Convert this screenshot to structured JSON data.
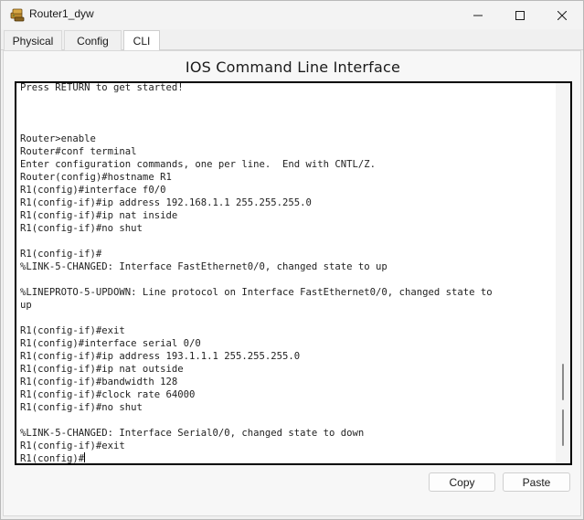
{
  "window": {
    "title": "Router1_dyw",
    "icon": "router-icon"
  },
  "tabs": [
    {
      "label": "Physical"
    },
    {
      "label": "Config"
    },
    {
      "label": "CLI",
      "selected": true
    }
  ],
  "cli": {
    "heading": "IOS Command Line Interface",
    "lines": [
      "Press RETURN to get started!",
      "",
      "",
      "",
      "Router>enable",
      "Router#conf terminal",
      "Enter configuration commands, one per line.  End with CNTL/Z.",
      "Router(config)#hostname R1",
      "R1(config)#interface f0/0",
      "R1(config-if)#ip address 192.168.1.1 255.255.255.0",
      "R1(config-if)#ip nat inside",
      "R1(config-if)#no shut",
      "",
      "R1(config-if)#",
      "%LINK-5-CHANGED: Interface FastEthernet0/0, changed state to up",
      "",
      "%LINEPROTO-5-UPDOWN: Line protocol on Interface FastEthernet0/0, changed state to",
      "up",
      "",
      "R1(config-if)#exit",
      "R1(config)#interface serial 0/0",
      "R1(config-if)#ip address 193.1.1.1 255.255.255.0",
      "R1(config-if)#ip nat outside",
      "R1(config-if)#bandwidth 128",
      "R1(config-if)#clock rate 64000",
      "R1(config-if)#no shut",
      "",
      "%LINK-5-CHANGED: Interface Serial0/0, changed state to down",
      "R1(config-if)#exit"
    ],
    "prompt": "R1(config)#"
  },
  "buttons": {
    "copy": "Copy",
    "paste": "Paste"
  }
}
